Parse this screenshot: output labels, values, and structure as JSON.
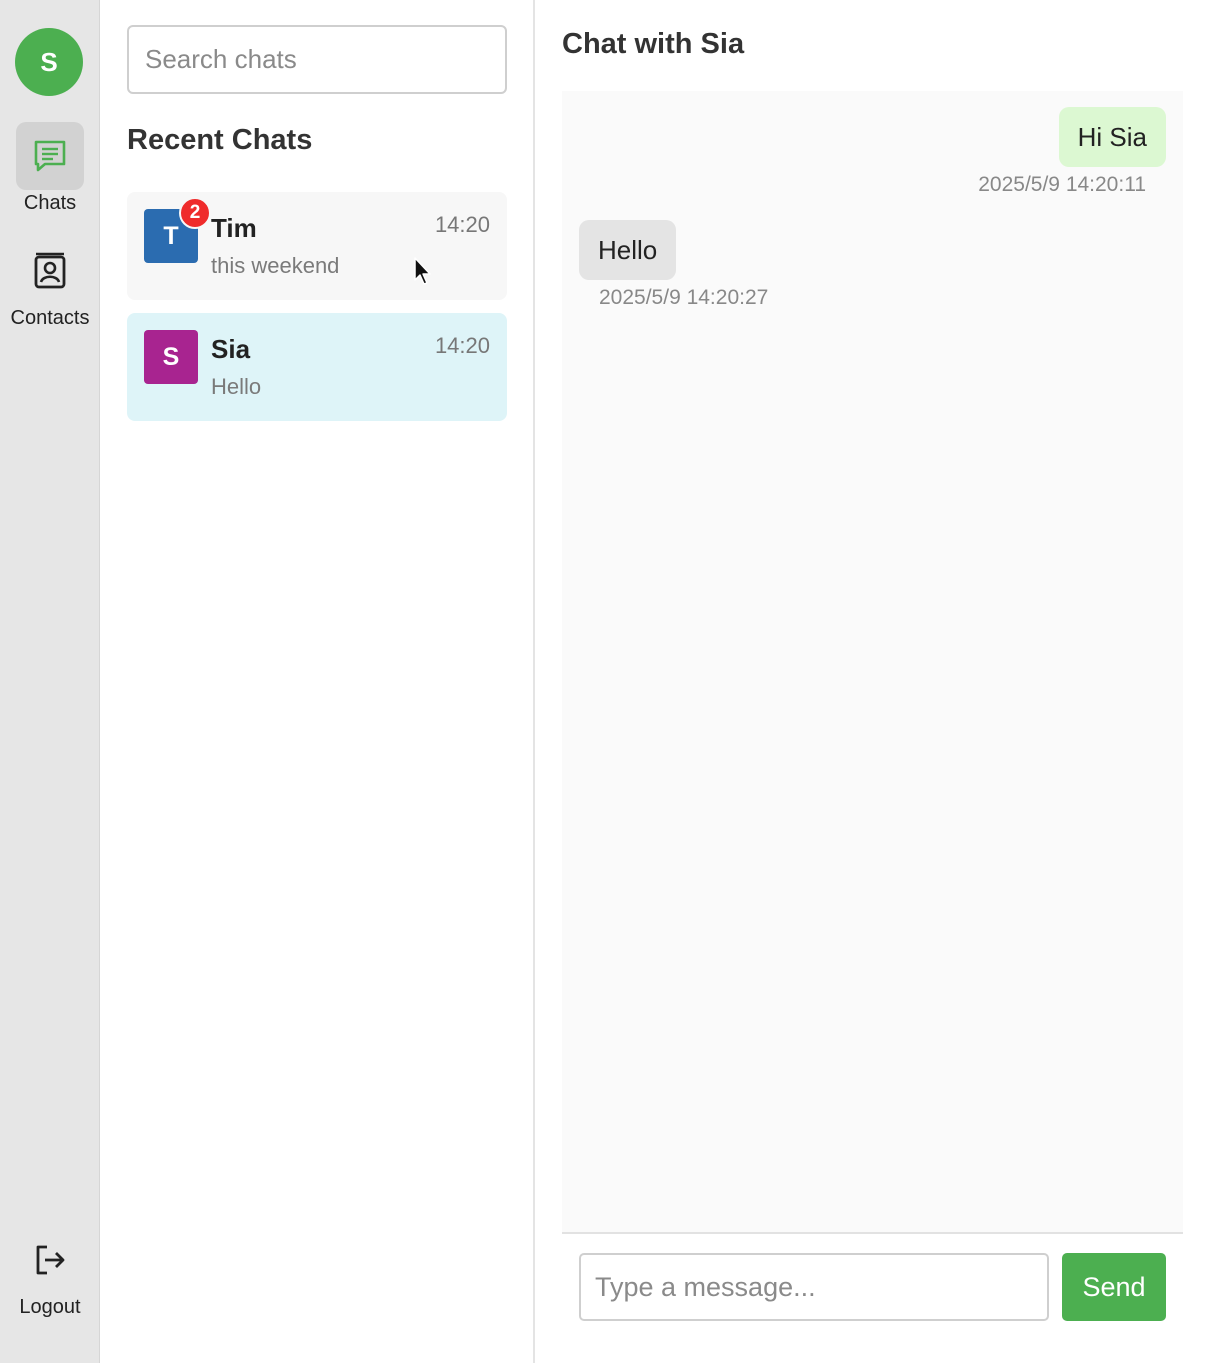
{
  "user": {
    "avatar_letter": "S",
    "avatar_color": "#4caf50"
  },
  "nav": {
    "chats_label": "Chats",
    "contacts_label": "Contacts",
    "logout_label": "Logout"
  },
  "chat_list": {
    "search_placeholder": "Search chats",
    "title": "Recent Chats",
    "items": [
      {
        "letter": "T",
        "name": "Tim",
        "time": "14:20",
        "preview": "this weekend",
        "unread": "2",
        "avatar_color": "#2b6cb0"
      },
      {
        "letter": "S",
        "name": "Sia",
        "time": "14:20",
        "preview": "Hello",
        "avatar_color": "#a82490"
      }
    ]
  },
  "conversation": {
    "title": "Chat with Sia",
    "messages": [
      {
        "direction": "out",
        "text": "Hi Sia",
        "timestamp": "2025/5/9 14:20:11"
      },
      {
        "direction": "in",
        "text": "Hello",
        "timestamp": "2025/5/9 14:20:27"
      }
    ],
    "input_placeholder": "Type a message...",
    "send_label": "Send"
  },
  "icons": {
    "chats": "chat-bubble-icon",
    "contacts": "contact-card-icon",
    "logout": "logout-icon"
  },
  "colors": {
    "accent": "#4caf50",
    "active_chat_bg": "#def4f8",
    "outgoing_bubble": "#dcf8d2",
    "incoming_bubble": "#e4e4e4",
    "unread_badge": "#ef2b2b"
  }
}
